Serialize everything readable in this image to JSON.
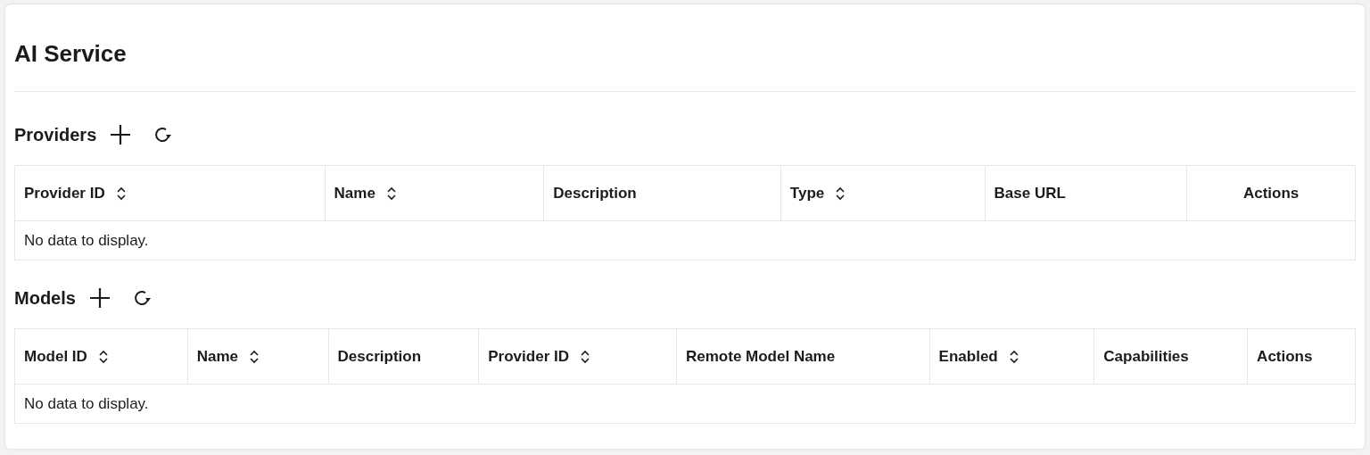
{
  "title": "AI Service",
  "sections": [
    {
      "heading": "Providers",
      "table": {
        "columns": [
          {
            "label": "Provider ID",
            "sortable": true
          },
          {
            "label": "Name",
            "sortable": true
          },
          {
            "label": "Description",
            "sortable": false
          },
          {
            "label": "Type",
            "sortable": true
          },
          {
            "label": "Base URL",
            "sortable": false
          },
          {
            "label": "Actions",
            "sortable": false
          }
        ],
        "empty_message": "No data to display."
      }
    },
    {
      "heading": "Models",
      "table": {
        "columns": [
          {
            "label": "Model ID",
            "sortable": true
          },
          {
            "label": "Name",
            "sortable": true
          },
          {
            "label": "Description",
            "sortable": false
          },
          {
            "label": "Provider ID",
            "sortable": true
          },
          {
            "label": "Remote Model Name",
            "sortable": false
          },
          {
            "label": "Enabled",
            "sortable": true
          },
          {
            "label": "Capabilities",
            "sortable": false
          },
          {
            "label": "Actions",
            "sortable": false
          }
        ],
        "empty_message": "No data to display."
      }
    }
  ]
}
